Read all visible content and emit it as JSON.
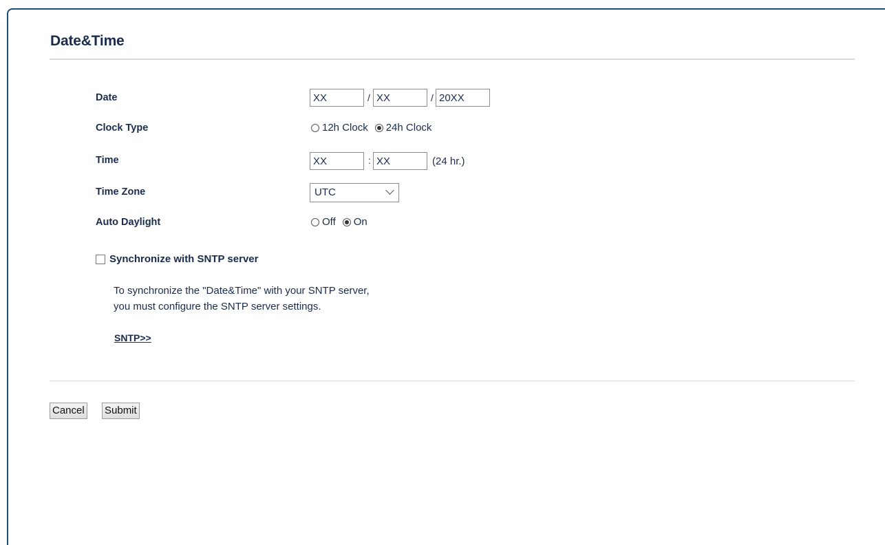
{
  "page": {
    "title": "Date&Time"
  },
  "date": {
    "label": "Date",
    "month": "XX",
    "day": "XX",
    "year": "20XX",
    "separator": "/"
  },
  "clock_type": {
    "label": "Clock Type",
    "options": [
      "12h Clock",
      "24h Clock"
    ],
    "selected": "24h Clock"
  },
  "time": {
    "label": "Time",
    "hour": "XX",
    "minute": "XX",
    "separator": ":",
    "unit_note": "(24 hr.)"
  },
  "time_zone": {
    "label": "Time Zone",
    "selected": "UTC"
  },
  "auto_daylight": {
    "label": "Auto Daylight",
    "options": [
      "Off",
      "On"
    ],
    "selected": "On"
  },
  "sntp": {
    "checkbox_label": "Synchronize with SNTP server",
    "checked": false,
    "help_line_1": "To synchronize the \"Date&Time\" with your SNTP server,",
    "help_line_2": "you must configure the SNTP server settings.",
    "link_label": "SNTP>>"
  },
  "actions": {
    "cancel_label": "Cancel",
    "submit_label": "Submit"
  },
  "colors": {
    "frame_border": "#1f4e79",
    "text": "#1a2b4c"
  }
}
